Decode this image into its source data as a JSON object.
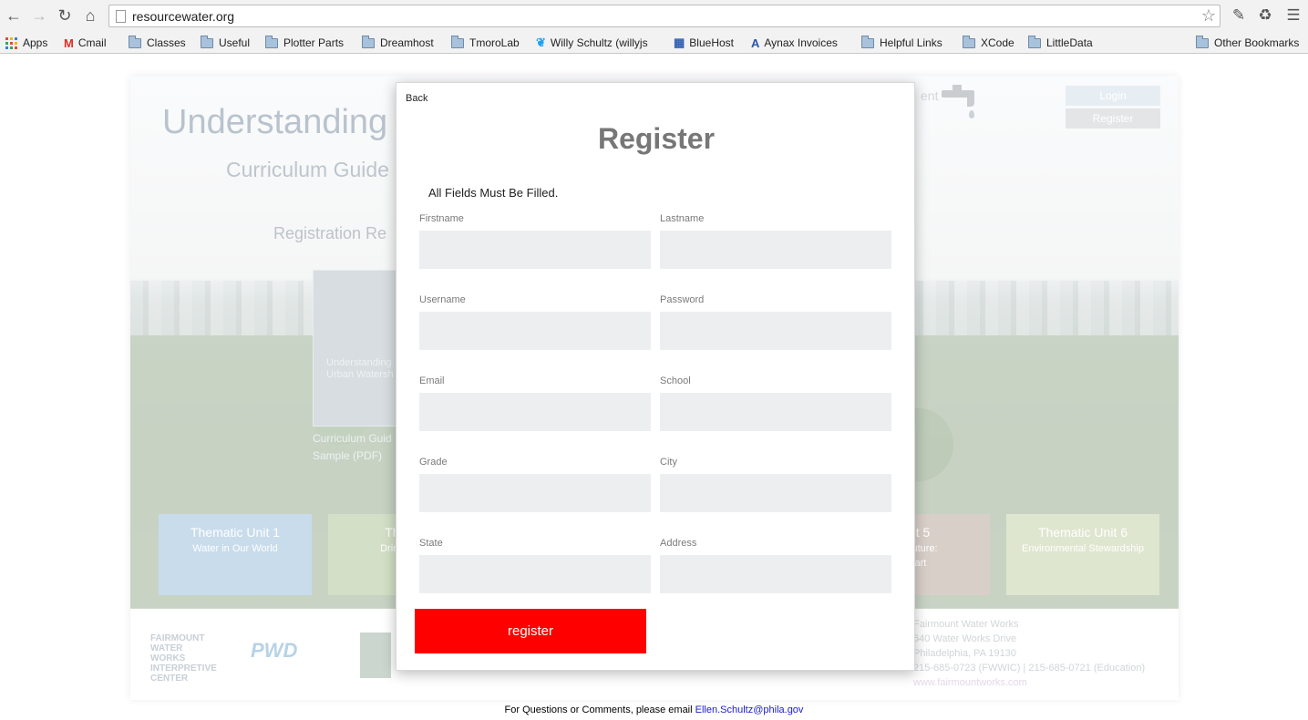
{
  "browser": {
    "url": "resourcewater.org",
    "bookmarks": [
      {
        "label": "Apps",
        "icon": "apps-icon"
      },
      {
        "label": "Cmail",
        "icon": "gmail-icon"
      },
      {
        "label": "Classes",
        "icon": "folder-icon"
      },
      {
        "label": "Useful",
        "icon": "folder-icon"
      },
      {
        "label": "Plotter Parts",
        "icon": "folder-icon"
      },
      {
        "label": "Dreamhost",
        "icon": "folder-icon"
      },
      {
        "label": "TmoroLab",
        "icon": "folder-icon"
      },
      {
        "label": "Willy Schultz (willyjs",
        "icon": "twitter-icon"
      },
      {
        "label": "BlueHost",
        "icon": "grid-icon"
      },
      {
        "label": "Aynax Invoices",
        "icon": "aynax-icon"
      },
      {
        "label": "Helpful Links",
        "icon": "folder-icon"
      },
      {
        "label": "XCode",
        "icon": "folder-icon"
      },
      {
        "label": "LittleData",
        "icon": "folder-icon"
      },
      {
        "label": "Other Bookmarks",
        "icon": "folder-icon"
      }
    ]
  },
  "background": {
    "title": "Understanding",
    "subtitle": "Curriculum Guide",
    "registration_text": "Registration Re",
    "header_fragment": "ent",
    "login_label": "Login",
    "register_label": "Register",
    "book_text": "Understanding Urban Watersh",
    "book_caption_1": "Curriculum Guid",
    "book_caption_2": "Sample (PDF)",
    "units": [
      {
        "title": "Thematic Unit 1",
        "sub": "Water in Our World",
        "color": "#c9dcec"
      },
      {
        "title": "Thema",
        "sub": "Drinking W",
        "color": "#d3dfc6"
      },
      {
        "title": "Unit 5",
        "sub": "the Future:",
        "sub2": "s Part",
        "color": "#d9cfc9"
      },
      {
        "title": "Thematic Unit 6",
        "sub": "Environmental Stewardship",
        "color": "#dfe6cf"
      }
    ],
    "footer_logo_1": "FAIRMOUNT WATER WORKS INTERPRETIVE CENTER",
    "footer_logo_2": "PWD",
    "footer_info": {
      "line1": "Fairmount Water Works",
      "line2": "640 Water Works Drive",
      "line3": "Philadelphia, PA 19130",
      "line4": "215-685-0723 (FWWIC) | 215-685-0721 (Education)",
      "link": "www.fairmountworks.com"
    }
  },
  "footer_note": {
    "text": "For Questions or Comments, please email ",
    "email": "Ellen.Schultz@phila.gov"
  },
  "modal": {
    "back_label": "Back",
    "title": "Register",
    "note": "All Fields Must Be Filled.",
    "fields": {
      "firstname": "Firstname",
      "lastname": "Lastname",
      "username": "Username",
      "password": "Password",
      "email": "Email",
      "school": "School",
      "grade": "Grade",
      "city": "City",
      "state": "State",
      "address": "Address"
    },
    "submit_label": "register",
    "accent_color": "#ff0000"
  }
}
